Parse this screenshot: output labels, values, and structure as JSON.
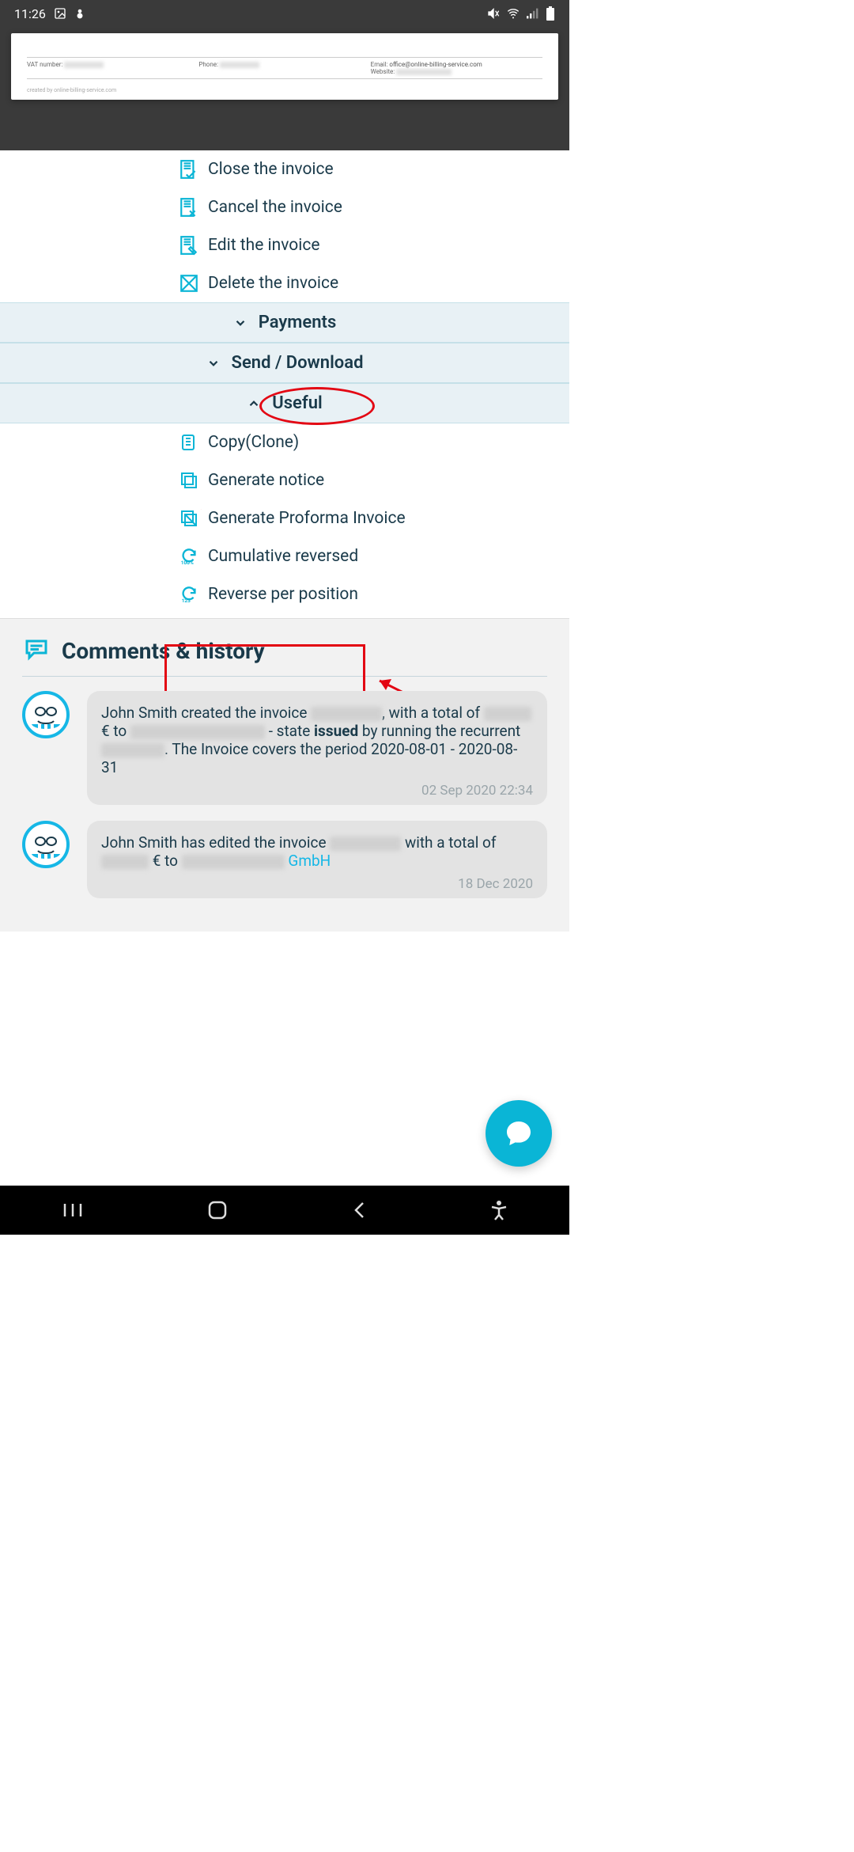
{
  "status": {
    "time": "11:26"
  },
  "invoice_preview": {
    "vat_label": "VAT number:",
    "phone_label": "Phone:",
    "email_label": "Email:",
    "email_value": "office@online-billing-service.com",
    "website_label": "Website:",
    "footer": "created by online-billing-service.com"
  },
  "actions": {
    "close": "Close the invoice",
    "cancel": "Cancel the invoice",
    "edit": "Edit the invoice",
    "delete": "Delete the invoice"
  },
  "accordions": {
    "payments": "Payments",
    "send_download": "Send / Download",
    "useful": "Useful"
  },
  "useful_items": {
    "copy": "Copy(Clone)",
    "notice": "Generate notice",
    "proforma": "Generate Proforma Invoice",
    "cumulative": "Cumulative reversed",
    "reverse_pos": "Reverse per position"
  },
  "comments": {
    "title": "Comments & history",
    "items": [
      {
        "user": "John Smith",
        "body_prefix": "John Smith created the invoice ",
        "body_mid1": ", with a total of ",
        "body_mid2": " € to ",
        "body_mid3": " - state ",
        "state": "issued",
        "body_mid4": " by running the recurrent ",
        "body_suffix": ". The Invoice covers the period 2020-08-01 - 2020-08-31",
        "time": "02 Sep 2020 22:34"
      },
      {
        "user": "John Smith",
        "body_prefix": "John Smith has edited the invoice ",
        "body_mid1": " with a total of ",
        "body_mid2": " € to ",
        "link": "GmbH",
        "time": "18 Dec 2020"
      }
    ]
  }
}
